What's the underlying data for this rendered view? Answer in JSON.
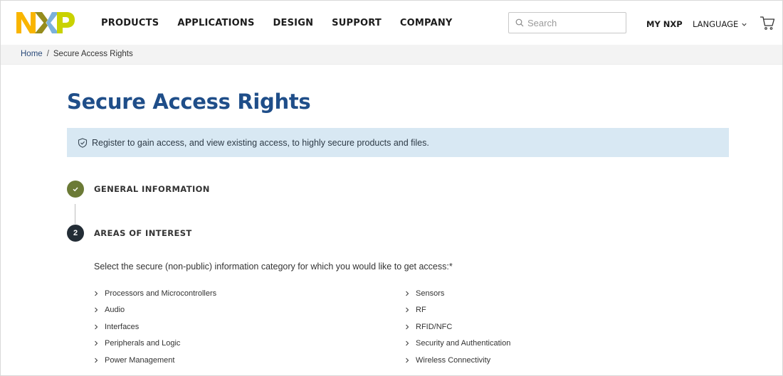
{
  "brand": {
    "logo_colors": {
      "n": "#F9B500",
      "x_left": "#958C1C",
      "x_right": "#7BB1DB",
      "p": "#C9D200"
    }
  },
  "nav": {
    "items": [
      "PRODUCTS",
      "APPLICATIONS",
      "DESIGN",
      "SUPPORT",
      "COMPANY"
    ]
  },
  "search": {
    "placeholder": "Search"
  },
  "utility": {
    "my_nxp": "MY NXP",
    "language": "LANGUAGE"
  },
  "breadcrumb": {
    "home": "Home",
    "separator": "/",
    "current": "Secure Access Rights"
  },
  "page": {
    "title": "Secure Access Rights",
    "notice": "Register to gain access, and view existing access, to highly secure products and files."
  },
  "steps": [
    {
      "number": "",
      "label": "GENERAL INFORMATION",
      "status": "completed"
    },
    {
      "number": "2",
      "label": "AREAS OF INTEREST",
      "status": "active"
    }
  ],
  "categories": {
    "prompt": "Select the secure (non-public) information category for which you would like to get access:*",
    "left": [
      "Processors and Microcontrollers",
      "Audio",
      "Interfaces",
      "Peripherals and Logic",
      "Power Management"
    ],
    "right": [
      "Sensors",
      "RF",
      "RFID/NFC",
      "Security and Authentication",
      "Wireless Connectivity"
    ]
  },
  "colors": {
    "title": "#1f4e89",
    "notice_bg": "#d8e8f3",
    "step_done": "#6b7a36",
    "step_active": "#232d36"
  }
}
